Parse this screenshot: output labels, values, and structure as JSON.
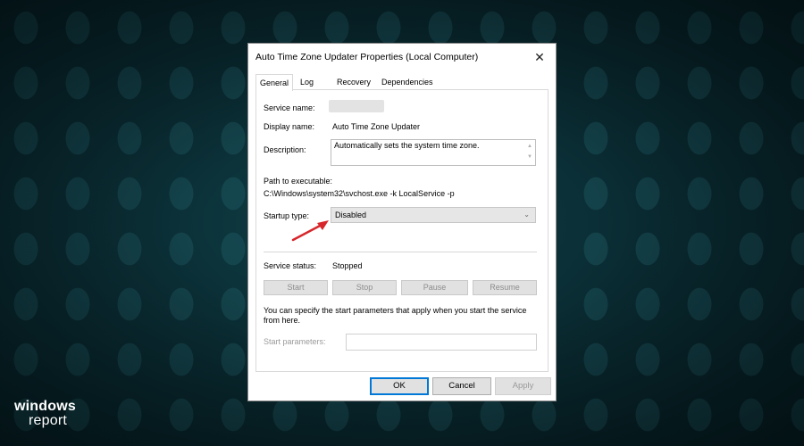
{
  "dialog": {
    "title": "Auto Time Zone Updater Properties (Local Computer)",
    "close_glyph": "✕",
    "tabs": [
      "General",
      "Log On",
      "Recovery",
      "Dependencies"
    ],
    "active_tab": "General"
  },
  "general": {
    "service_name_label": "Service name:",
    "display_name_label": "Display name:",
    "display_name_value": "Auto Time Zone Updater",
    "description_label": "Description:",
    "description_value": "Automatically sets the system time zone.",
    "path_label": "Path to executable:",
    "path_value": "C:\\Windows\\system32\\svchost.exe -k LocalService -p",
    "startup_type_label": "Startup type:",
    "startup_type_value": "Disabled",
    "service_status_label": "Service status:",
    "service_status_value": "Stopped",
    "buttons": {
      "start": "Start",
      "stop": "Stop",
      "pause": "Pause",
      "resume": "Resume"
    },
    "info_text": "You can specify the start parameters that apply when you start the service from here.",
    "start_params_label": "Start parameters:",
    "start_params_value": ""
  },
  "footer": {
    "ok": "OK",
    "cancel": "Cancel",
    "apply": "Apply"
  },
  "watermark": {
    "line1": "windows",
    "line2": "report"
  },
  "colors": {
    "arrow": "#d7262b",
    "accent": "#0078d7",
    "background": "#0a2c33"
  }
}
